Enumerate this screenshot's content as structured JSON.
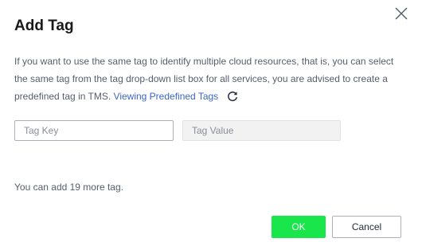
{
  "dialog": {
    "title": "Add Tag",
    "close_icon": "close-icon",
    "description": "If you want to use the same tag to identify multiple cloud resources, that is, you can select the same tag from the tag drop-down list box for all services, you are advised to create a predefined tag in TMS.",
    "link_label": "Viewing Predefined Tags",
    "refresh_icon": "refresh-icon"
  },
  "tag_key": {
    "placeholder": "Tag Key",
    "value": ""
  },
  "tag_value": {
    "placeholder": "Tag Value",
    "value": ""
  },
  "remaining_text": "You can add 19 more tag.",
  "buttons": {
    "ok_label": "OK",
    "cancel_label": "Cancel"
  },
  "colors": {
    "ok_button": "#19e64b",
    "link": "#3a66c5",
    "disabled_field": "#f2f2f2"
  }
}
